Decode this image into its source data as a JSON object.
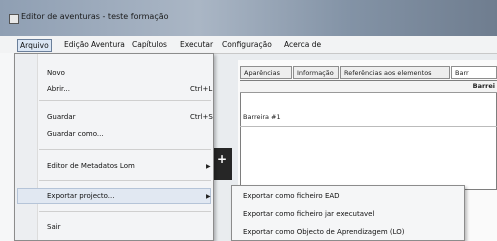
{
  "window": {
    "title": "Editor de aventuras - teste formação"
  },
  "menubar": {
    "items": [
      "Arquivo",
      "Edição",
      "Aventura",
      "Capítulos",
      "Executar",
      "Configuração",
      "Acerca de"
    ]
  },
  "file_menu": {
    "items": [
      {
        "label": "Novo",
        "shortcut": ""
      },
      {
        "label": "Abrir...",
        "shortcut": "Ctrl+L"
      },
      {
        "label": "Guardar",
        "shortcut": "Ctrl+S"
      },
      {
        "label": "Guardar como...",
        "shortcut": ""
      },
      {
        "label": "Editor de Metadatos Lom",
        "shortcut": ""
      },
      {
        "label": "Exportar projecto...",
        "shortcut": ""
      },
      {
        "label": "Sair",
        "shortcut": ""
      }
    ]
  },
  "export_submenu": {
    "items": [
      "Exportar como ficheiro EAD",
      "Exportar como ficheiro jar executavel",
      "Exportar como Objecto de Aprendizagem (LO)"
    ]
  },
  "tabs": [
    "Aparências",
    "Informação",
    "Referências aos elementos",
    "Barr"
  ],
  "table": {
    "header": "Barrei",
    "rows": [
      "Barreira #1"
    ]
  },
  "accent": {
    "menu_highlight": "#e1e8f2",
    "titlebar": "#8f9fb3"
  }
}
